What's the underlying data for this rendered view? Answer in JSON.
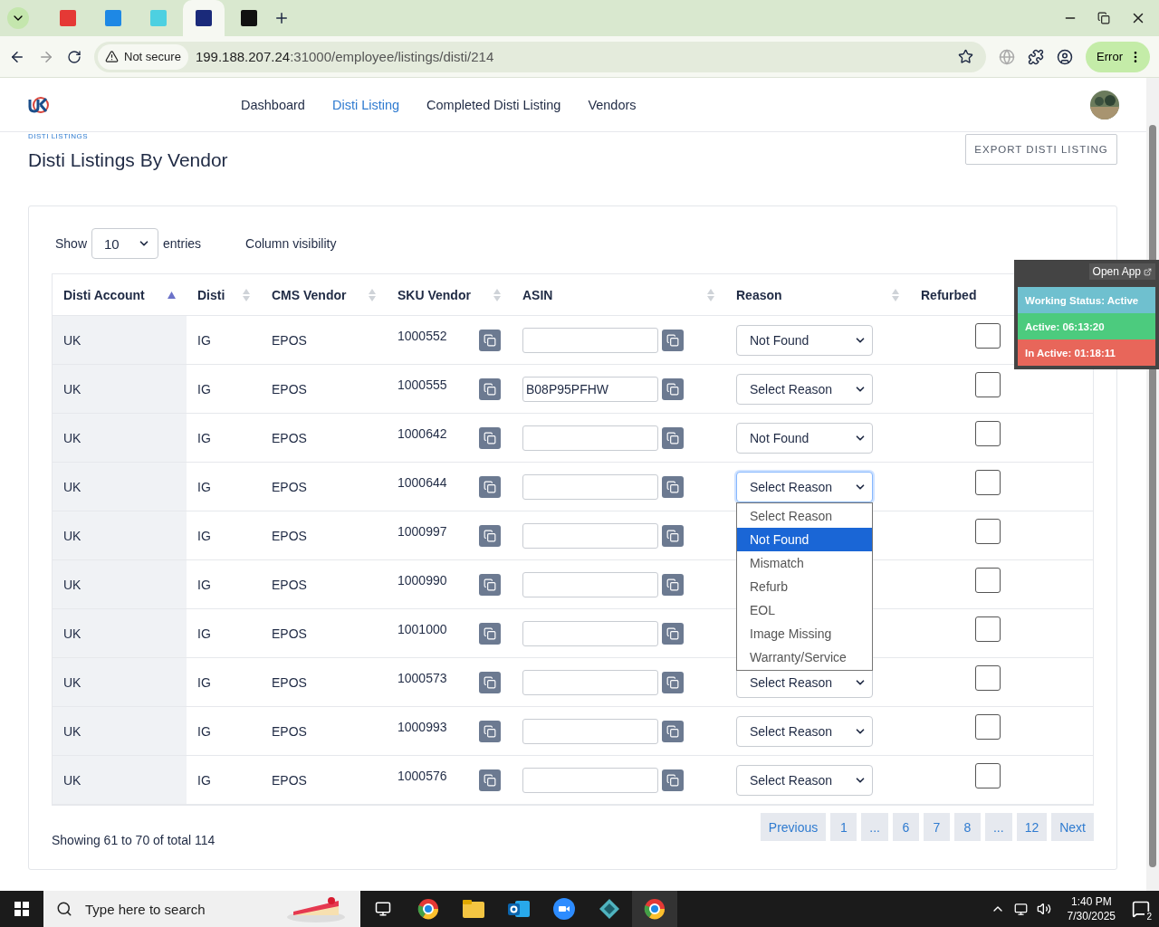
{
  "browser": {
    "tabs": [
      {
        "kind": "red",
        "selected": false
      },
      {
        "kind": "blue",
        "selected": false
      },
      {
        "kind": "cyan",
        "selected": false
      },
      {
        "kind": "navy",
        "selected": true
      },
      {
        "kind": "black",
        "selected": false
      }
    ],
    "security": "Not secure",
    "url_host": "199.188.207.24",
    "url_path": ":31000/employee/listings/disti/214",
    "profile_status": "Error"
  },
  "nav": {
    "items": [
      {
        "label": "Dashboard",
        "selected": false
      },
      {
        "label": "Disti Listing",
        "selected": true
      },
      {
        "label": "Completed Disti Listing",
        "selected": false
      },
      {
        "label": "Vendors",
        "selected": false
      }
    ]
  },
  "breadcrumb": "DISTI LISTINGS",
  "title": "Disti Listings By Vendor",
  "export_button": "EXPORT DISTI LISTING",
  "widget": {
    "link": "Open App",
    "status": "Working Status: Active",
    "active": "Active: 06:13:20",
    "inactive": "In Active: 01:18:11"
  },
  "length": {
    "before": "Show",
    "value": "10",
    "after": "entries"
  },
  "column_visibility": "Column visibility",
  "table": {
    "columns": [
      {
        "label": "Disti Account",
        "sorted": true
      },
      {
        "label": "Disti",
        "sorted": false
      },
      {
        "label": "CMS Vendor",
        "sorted": false
      },
      {
        "label": "SKU Vendor",
        "sorted": false
      },
      {
        "label": "ASIN",
        "sorted": false
      },
      {
        "label": "Reason",
        "sorted": false
      },
      {
        "label": "Refurbed"
      }
    ],
    "rows": [
      {
        "account": "UK",
        "disti": "IG",
        "vendor": "EPOS",
        "sku": "1000552",
        "asin": "",
        "reason": "Not Found",
        "refurbed": false
      },
      {
        "account": "UK",
        "disti": "IG",
        "vendor": "EPOS",
        "sku": "1000555",
        "asin": "B08P95PFHW",
        "reason": "Select Reason",
        "refurbed": false
      },
      {
        "account": "UK",
        "disti": "IG",
        "vendor": "EPOS",
        "sku": "1000642",
        "asin": "",
        "reason": "Not Found",
        "refurbed": false
      },
      {
        "account": "UK",
        "disti": "IG",
        "vendor": "EPOS",
        "sku": "1000644",
        "asin": "",
        "reason": "Select Reason",
        "refurbed": false,
        "open": true,
        "options": [
          {
            "label": "Select Reason",
            "selected": false
          },
          {
            "label": "Not Found",
            "selected": true
          },
          {
            "label": "Mismatch",
            "selected": false
          },
          {
            "label": "Refurb",
            "selected": false
          },
          {
            "label": "EOL",
            "selected": false
          },
          {
            "label": "Image Missing",
            "selected": false
          },
          {
            "label": "Warranty/Service",
            "selected": false
          }
        ]
      },
      {
        "account": "UK",
        "disti": "IG",
        "vendor": "EPOS",
        "sku": "1000997",
        "asin": "",
        "refurbed": false
      },
      {
        "account": "UK",
        "disti": "IG",
        "vendor": "EPOS",
        "sku": "1000990",
        "asin": "",
        "refurbed": false
      },
      {
        "account": "UK",
        "disti": "IG",
        "vendor": "EPOS",
        "sku": "1001000",
        "asin": "",
        "refurbed": false
      },
      {
        "account": "UK",
        "disti": "IG",
        "vendor": "EPOS",
        "sku": "1000573",
        "asin": "",
        "reason": "Select Reason",
        "refurbed": false
      },
      {
        "account": "UK",
        "disti": "IG",
        "vendor": "EPOS",
        "sku": "1000993",
        "asin": "",
        "reason": "Select Reason",
        "refurbed": false
      },
      {
        "account": "UK",
        "disti": "IG",
        "vendor": "EPOS",
        "sku": "1000576",
        "asin": "",
        "reason": "Select Reason",
        "refurbed": false
      }
    ]
  },
  "info": "Showing 61 to 70 of total 114",
  "pagination": [
    "Previous",
    "1",
    "...",
    "6",
    "7",
    "8",
    "...",
    "12",
    "Next"
  ],
  "taskbar": {
    "search_placeholder": "Type here to search",
    "time": "1:40 PM",
    "date": "7/30/2025",
    "notifications": "2"
  }
}
